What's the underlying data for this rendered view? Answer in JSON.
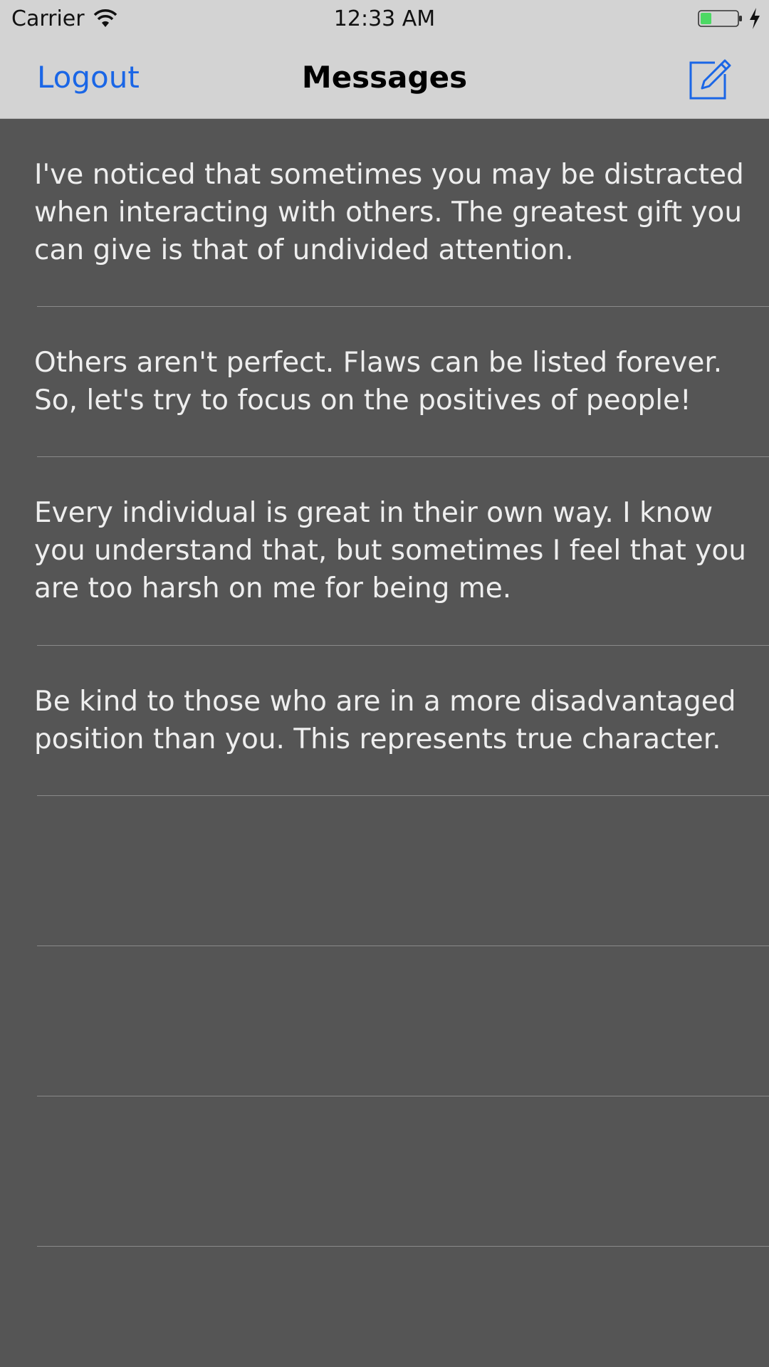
{
  "status_bar": {
    "carrier": "Carrier",
    "time": "12:33 AM",
    "wifi_icon": "wifi-icon",
    "battery_icon": "battery-icon",
    "charging_icon": "bolt-icon",
    "battery_level": 0.3,
    "battery_color": "#4cd964"
  },
  "nav_bar": {
    "left_button": "Logout",
    "title": "Messages",
    "right_icon": "compose-icon",
    "accent_color": "#1a66e6"
  },
  "messages": [
    "I've noticed that sometimes you may be distracted when interacting with others. The greatest gift you can give is that of undivided attention.",
    "Others aren't perfect. Flaws can be listed forever. So, let's try to focus on the positives of people!",
    "Every individual is great in their own way. I know you understand that, but sometimes I feel that you are too harsh on me for being me.",
    "Be kind to those who are in a more disadvantaged position than you. This represents true character."
  ]
}
